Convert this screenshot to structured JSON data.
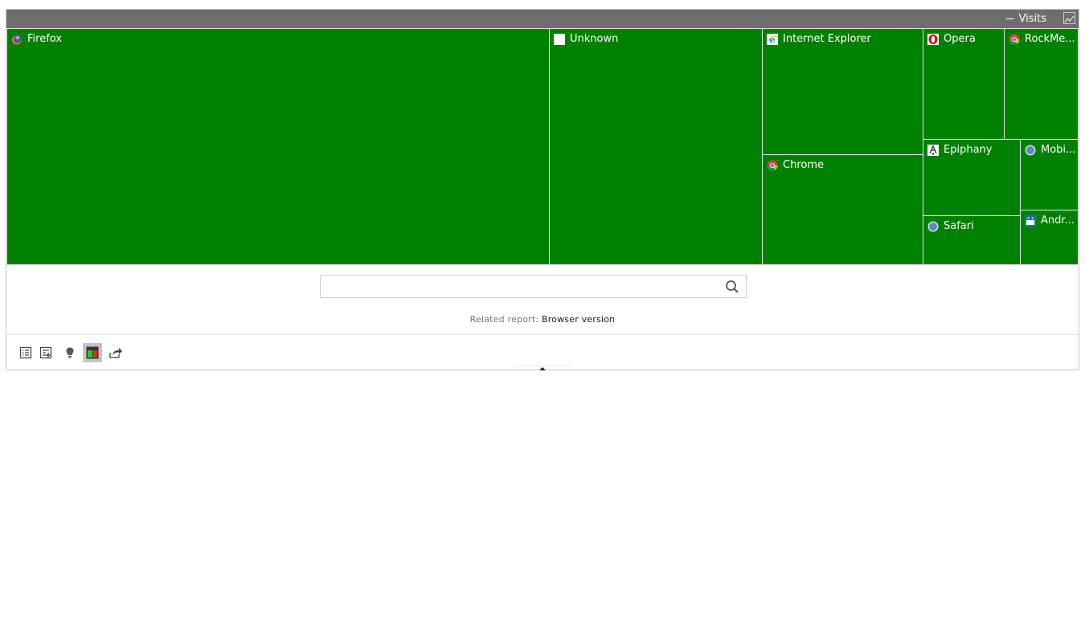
{
  "header": {
    "metric_label": "Visits"
  },
  "treemap": {
    "color": "#008000",
    "cells": [
      {
        "label": "Firefox",
        "icon": "firefox-icon"
      },
      {
        "label": "Unknown",
        "icon": "unknown-icon"
      },
      {
        "label": "Internet Explorer",
        "icon": "internet-explorer-icon"
      },
      {
        "label": "Chrome",
        "icon": "chrome-icon"
      },
      {
        "label": "Opera",
        "icon": "opera-icon"
      },
      {
        "label": "RockMe...",
        "icon": "rockmelt-icon"
      },
      {
        "label": "Epiphany",
        "icon": "epiphany-icon"
      },
      {
        "label": "Safari",
        "icon": "safari-icon"
      },
      {
        "label": "Mobi...",
        "icon": "mobile-browser-icon"
      },
      {
        "label": "Andr...",
        "icon": "android-icon"
      }
    ]
  },
  "search": {
    "value": "",
    "placeholder": ""
  },
  "related": {
    "prefix": "Related report:",
    "link": "Browser version"
  },
  "toolbar": {
    "tools": [
      "table-icon",
      "table-more-columns-icon",
      "insight-bulb-icon",
      "treemap-icon",
      "export-icon"
    ]
  }
}
